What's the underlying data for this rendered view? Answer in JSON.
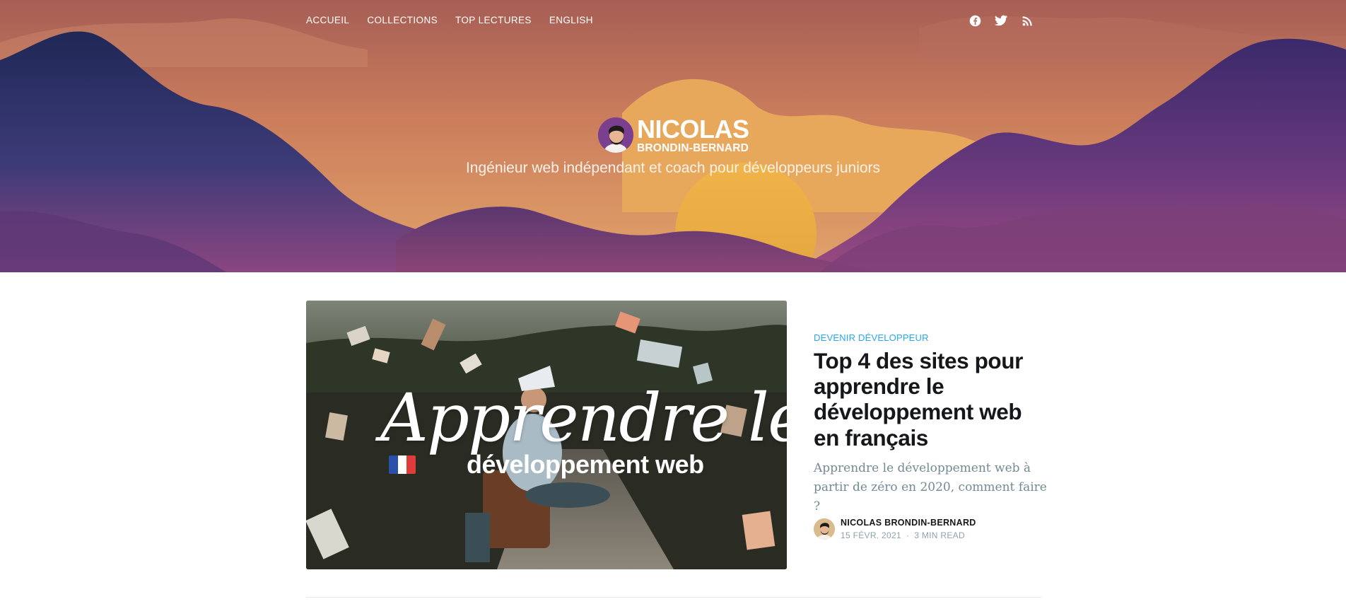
{
  "colors": {
    "accent": "#26a8ed",
    "title": "#15171a",
    "excerpt": "#738a94",
    "meta": "#90a2aa"
  },
  "nav": {
    "items": [
      {
        "label": "Accueil"
      },
      {
        "label": "Collections"
      },
      {
        "label": "Top lectures"
      },
      {
        "label": "English"
      }
    ]
  },
  "social": {
    "icons": [
      "facebook-icon",
      "twitter-icon",
      "rss-icon"
    ]
  },
  "logo": {
    "first": "NICOLAS",
    "last": "BRONDIN-BERNARD"
  },
  "tagline": "Ingénieur web indépendant et coach pour développeurs juniors",
  "post": {
    "image": {
      "script_text": "Apprendre le",
      "sub_text": "développement web"
    },
    "tag": "Devenir développeur",
    "title": "Top 4 des sites pour apprendre le développement web en français",
    "excerpt": "Apprendre le développement web à partir de zéro en 2020, comment faire ?",
    "author": "Nicolas Brondin-Bernard",
    "date": "15 févr. 2021",
    "separator": "·",
    "reading_time": "3 min read"
  }
}
